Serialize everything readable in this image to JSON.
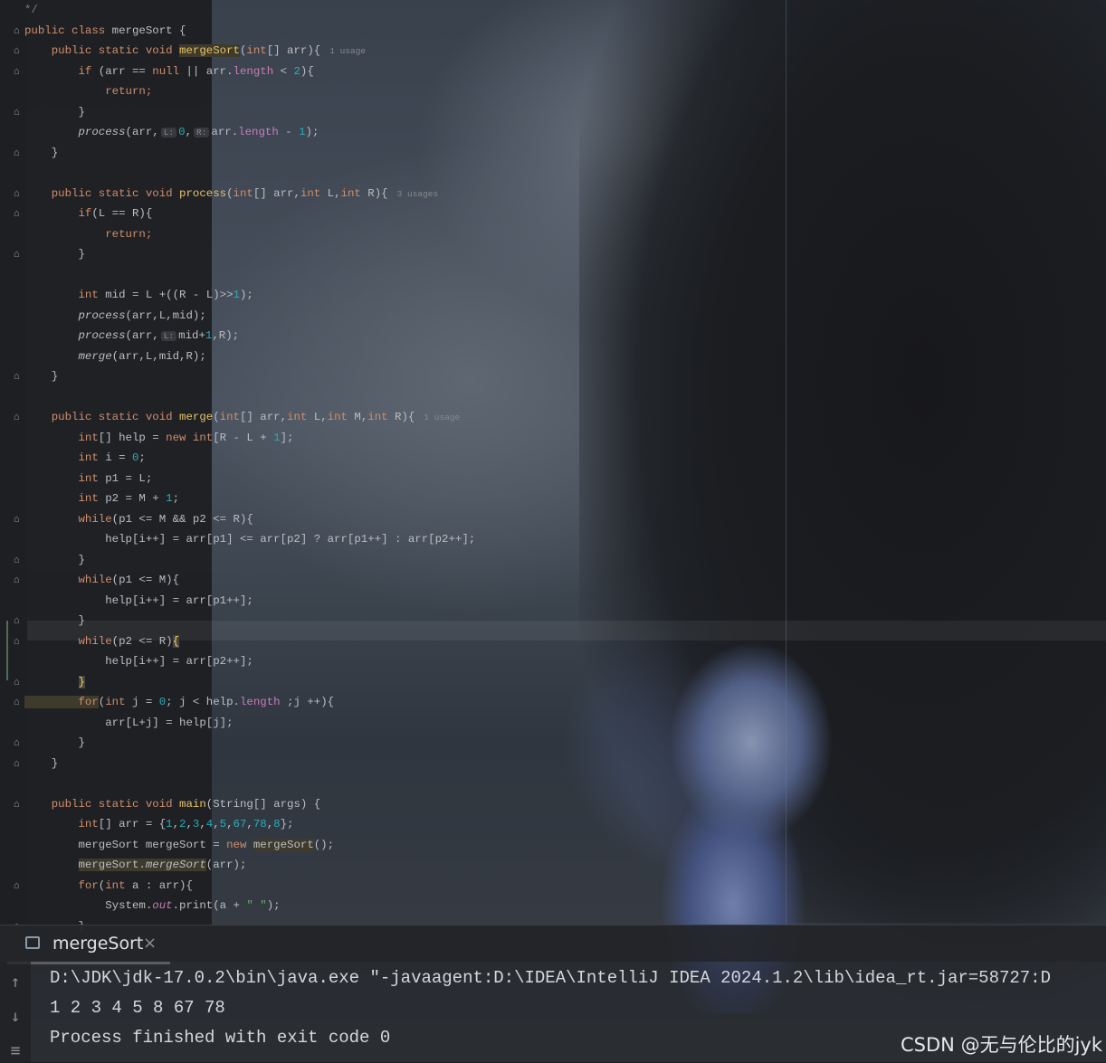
{
  "editor": {
    "file_class": "mergeSort",
    "lines": [
      [
        {
          "t": "*/",
          "c": "cmt"
        }
      ],
      [
        {
          "t": "public class ",
          "c": "kw"
        },
        {
          "t": "mergeSort {",
          "c": "punc"
        }
      ],
      [
        {
          "t": "    public static void ",
          "c": "kw"
        },
        {
          "t": "mergeSort",
          "c": "fnd hl"
        },
        {
          "t": "(",
          "c": "punc"
        },
        {
          "t": "int",
          "c": "kw"
        },
        {
          "t": "[] arr){",
          "c": "punc"
        },
        {
          "t": "1 usage",
          "c": "usage"
        }
      ],
      [
        {
          "t": "        if ",
          "c": "kw"
        },
        {
          "t": "(arr == ",
          "c": "punc"
        },
        {
          "t": "null",
          "c": "kw"
        },
        {
          "t": " || arr.",
          "c": "punc"
        },
        {
          "t": "length",
          "c": "field"
        },
        {
          "t": " < ",
          "c": "punc"
        },
        {
          "t": "2",
          "c": "num"
        },
        {
          "t": "){",
          "c": "punc"
        }
      ],
      [
        {
          "t": "            return;",
          "c": "kw"
        }
      ],
      [
        {
          "t": "        }",
          "c": "punc"
        }
      ],
      [
        {
          "t": "        process",
          "c": "it"
        },
        {
          "t": "(arr,",
          "c": "punc"
        },
        {
          "t": "L:",
          "c": "hint"
        },
        {
          "t": "0",
          "c": "num"
        },
        {
          "t": ",",
          "c": "punc"
        },
        {
          "t": "R:",
          "c": "hint"
        },
        {
          "t": "arr.",
          "c": "punc"
        },
        {
          "t": "length",
          "c": "field"
        },
        {
          "t": " - ",
          "c": "punc"
        },
        {
          "t": "1",
          "c": "num"
        },
        {
          "t": ");",
          "c": "punc"
        }
      ],
      [
        {
          "t": "    }",
          "c": "punc"
        }
      ],
      [
        {
          "t": "",
          "c": "punc"
        }
      ],
      [
        {
          "t": "    public static void ",
          "c": "kw"
        },
        {
          "t": "process",
          "c": "fnd"
        },
        {
          "t": "(",
          "c": "punc"
        },
        {
          "t": "int",
          "c": "kw"
        },
        {
          "t": "[] arr,",
          "c": "punc"
        },
        {
          "t": "int",
          "c": "kw"
        },
        {
          "t": " L,",
          "c": "punc"
        },
        {
          "t": "int",
          "c": "kw"
        },
        {
          "t": " R){",
          "c": "punc"
        },
        {
          "t": "3 usages",
          "c": "usage"
        }
      ],
      [
        {
          "t": "        if",
          "c": "kw"
        },
        {
          "t": "(L == R){",
          "c": "punc"
        }
      ],
      [
        {
          "t": "            return;",
          "c": "kw"
        }
      ],
      [
        {
          "t": "        }",
          "c": "punc"
        }
      ],
      [
        {
          "t": "",
          "c": "punc"
        }
      ],
      [
        {
          "t": "        int",
          "c": "kw"
        },
        {
          "t": " mid = L +((R - L)>>",
          "c": "punc"
        },
        {
          "t": "1",
          "c": "num"
        },
        {
          "t": ");",
          "c": "punc"
        }
      ],
      [
        {
          "t": "        process",
          "c": "it"
        },
        {
          "t": "(arr,L,mid);",
          "c": "punc"
        }
      ],
      [
        {
          "t": "        process",
          "c": "it"
        },
        {
          "t": "(arr,",
          "c": "punc"
        },
        {
          "t": "L:",
          "c": "hint"
        },
        {
          "t": "mid+",
          "c": "punc"
        },
        {
          "t": "1",
          "c": "num"
        },
        {
          "t": ",R);",
          "c": "punc"
        }
      ],
      [
        {
          "t": "        merge",
          "c": "it"
        },
        {
          "t": "(arr,L,mid,R);",
          "c": "punc"
        }
      ],
      [
        {
          "t": "    }",
          "c": "punc"
        }
      ],
      [
        {
          "t": "",
          "c": "punc"
        }
      ],
      [
        {
          "t": "    public static void ",
          "c": "kw"
        },
        {
          "t": "merge",
          "c": "fnd"
        },
        {
          "t": "(",
          "c": "punc"
        },
        {
          "t": "int",
          "c": "kw"
        },
        {
          "t": "[] arr,",
          "c": "punc"
        },
        {
          "t": "int",
          "c": "kw"
        },
        {
          "t": " L,",
          "c": "punc"
        },
        {
          "t": "int",
          "c": "kw"
        },
        {
          "t": " M,",
          "c": "punc"
        },
        {
          "t": "int",
          "c": "kw"
        },
        {
          "t": " R){",
          "c": "punc"
        },
        {
          "t": "1 usage",
          "c": "usage"
        }
      ],
      [
        {
          "t": "        int",
          "c": "kw"
        },
        {
          "t": "[] help = ",
          "c": "punc"
        },
        {
          "t": "new int",
          "c": "kw"
        },
        {
          "t": "[R - L + ",
          "c": "punc"
        },
        {
          "t": "1",
          "c": "num"
        },
        {
          "t": "];",
          "c": "punc"
        }
      ],
      [
        {
          "t": "        int",
          "c": "kw"
        },
        {
          "t": " i = ",
          "c": "punc"
        },
        {
          "t": "0",
          "c": "num"
        },
        {
          "t": ";",
          "c": "punc"
        }
      ],
      [
        {
          "t": "        int",
          "c": "kw"
        },
        {
          "t": " p1 = L;",
          "c": "punc"
        }
      ],
      [
        {
          "t": "        int",
          "c": "kw"
        },
        {
          "t": " p2 = M + ",
          "c": "punc"
        },
        {
          "t": "1",
          "c": "num"
        },
        {
          "t": ";",
          "c": "punc"
        }
      ],
      [
        {
          "t": "        while",
          "c": "kw"
        },
        {
          "t": "(p1 <= M && p2 <= R){",
          "c": "punc"
        }
      ],
      [
        {
          "t": "            help[i++] = arr[p1] <= arr[p2] ? arr[p1++] : arr[p2++];",
          "c": "punc"
        }
      ],
      [
        {
          "t": "        }",
          "c": "punc"
        }
      ],
      [
        {
          "t": "        while",
          "c": "kw"
        },
        {
          "t": "(p1 <= M){",
          "c": "punc"
        }
      ],
      [
        {
          "t": "            help[i++] = arr[p1++];",
          "c": "punc"
        }
      ],
      [
        {
          "t": "        }",
          "c": "punc"
        }
      ],
      [
        {
          "t": "        while",
          "c": "kw"
        },
        {
          "t": "(p2 <= R)",
          "c": "punc"
        },
        {
          "t": "{",
          "c": "brace-hl"
        }
      ],
      [
        {
          "t": "            help[i++] = arr[p2++];",
          "c": "punc"
        }
      ],
      [
        {
          "t": "        ",
          "c": "punc"
        },
        {
          "t": "}",
          "c": "brace-hl"
        }
      ],
      [
        {
          "t": "        for",
          "c": "kw hl"
        },
        {
          "t": "(",
          "c": "punc"
        },
        {
          "t": "int",
          "c": "kw"
        },
        {
          "t": " j = ",
          "c": "punc"
        },
        {
          "t": "0",
          "c": "num"
        },
        {
          "t": "; j < help.",
          "c": "punc"
        },
        {
          "t": "length",
          "c": "field"
        },
        {
          "t": " ;j ++){",
          "c": "punc"
        }
      ],
      [
        {
          "t": "            arr[L+j] = help[j];",
          "c": "punc"
        }
      ],
      [
        {
          "t": "        }",
          "c": "punc"
        }
      ],
      [
        {
          "t": "    }",
          "c": "punc"
        }
      ],
      [
        {
          "t": "",
          "c": "punc"
        }
      ],
      [
        {
          "t": "    public static void ",
          "c": "kw"
        },
        {
          "t": "main",
          "c": "fnd"
        },
        {
          "t": "(String[] args) {",
          "c": "punc"
        }
      ],
      [
        {
          "t": "        int",
          "c": "kw"
        },
        {
          "t": "[] arr = {",
          "c": "punc"
        },
        {
          "t": "1",
          "c": "num"
        },
        {
          "t": ",",
          "c": "punc"
        },
        {
          "t": "2",
          "c": "num"
        },
        {
          "t": ",",
          "c": "punc"
        },
        {
          "t": "3",
          "c": "num"
        },
        {
          "t": ",",
          "c": "punc"
        },
        {
          "t": "4",
          "c": "num"
        },
        {
          "t": ",",
          "c": "punc"
        },
        {
          "t": "5",
          "c": "num"
        },
        {
          "t": ",",
          "c": "punc"
        },
        {
          "t": "67",
          "c": "num"
        },
        {
          "t": ",",
          "c": "punc"
        },
        {
          "t": "78",
          "c": "num"
        },
        {
          "t": ",",
          "c": "punc"
        },
        {
          "t": "8",
          "c": "num"
        },
        {
          "t": "};",
          "c": "punc"
        }
      ],
      [
        {
          "t": "        mergeSort mergeSort = ",
          "c": "punc"
        },
        {
          "t": "new ",
          "c": "kw"
        },
        {
          "t": "mergeSort",
          "c": "punc hl"
        },
        {
          "t": "();",
          "c": "punc"
        }
      ],
      [
        {
          "t": "        ",
          "c": "punc"
        },
        {
          "t": "mergeSort.",
          "c": "punc hl"
        },
        {
          "t": "mergeSort",
          "c": "it hl"
        },
        {
          "t": "(arr);",
          "c": "punc"
        }
      ],
      [
        {
          "t": "        for",
          "c": "kw"
        },
        {
          "t": "(",
          "c": "punc"
        },
        {
          "t": "int",
          "c": "kw"
        },
        {
          "t": " a : arr){",
          "c": "punc"
        }
      ],
      [
        {
          "t": "            System.",
          "c": "punc"
        },
        {
          "t": "out",
          "c": "field it"
        },
        {
          "t": ".print(a + ",
          "c": "punc"
        },
        {
          "t": "\" \"",
          "c": "str"
        },
        {
          "t": ");",
          "c": "punc"
        }
      ],
      [
        {
          "t": "        }",
          "c": "punc"
        }
      ]
    ]
  },
  "run_panel": {
    "tab_label": "mergeSort",
    "tab_close": "×",
    "console_lines": [
      "D:\\JDK\\jdk-17.0.2\\bin\\java.exe \"-javaagent:D:\\IDEA\\IntelliJ IDEA 2024.1.2\\lib\\idea_rt.jar=58727:D",
      "1 2 3 4 5 8 67 78",
      "Process finished with exit code 0"
    ],
    "side_icons": [
      "up-arrow-icon",
      "down-arrow-icon",
      "soft-wrap-icon"
    ]
  },
  "watermark": "CSDN @无与伦比的jyk",
  "colors": {
    "keyword": "#cf8e6d",
    "function_decl": "#e8c46b",
    "number": "#2aacb8",
    "string": "#6aab73",
    "field": "#c77dbb",
    "text": "#bcbec4"
  }
}
